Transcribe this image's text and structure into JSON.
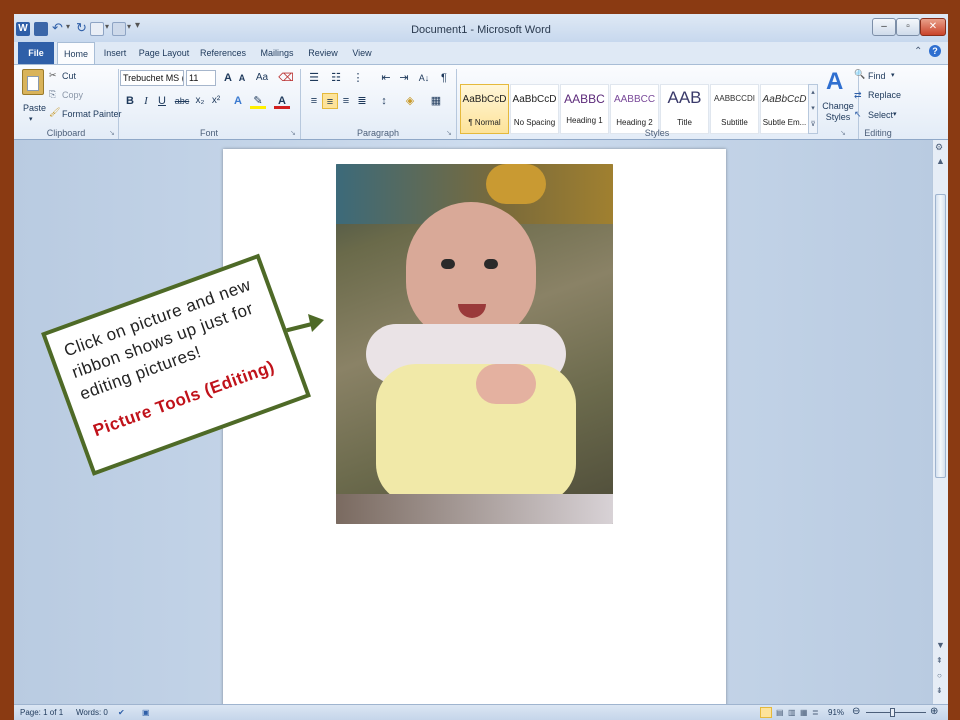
{
  "window": {
    "title": "Document1 - Microsoft Word",
    "qat_icons": [
      "word-app-icon",
      "save-icon",
      "undo-icon",
      "redo-icon",
      "new-doc-icon",
      "print-preview-icon",
      "customize-qat-icon"
    ]
  },
  "tabs": [
    "File",
    "Home",
    "Insert",
    "Page Layout",
    "References",
    "Mailings",
    "Review",
    "View"
  ],
  "active_tab": "Home",
  "clipboard": {
    "paste_label": "Paste",
    "cut_label": "Cut",
    "copy_label": "Copy",
    "format_painter_label": "Format Painter",
    "group_label": "Clipboard"
  },
  "font": {
    "font_name": "Trebuchet MS (H",
    "font_size": "11",
    "group_label": "Font"
  },
  "paragraph": {
    "group_label": "Paragraph"
  },
  "styles": {
    "items": [
      {
        "sample": "AaBbCcD",
        "name": "¶ Normal",
        "color": "#1f1f1f"
      },
      {
        "sample": "AaBbCcD",
        "name": "No Spacing",
        "color": "#1f1f1f"
      },
      {
        "sample": "AABBC",
        "name": "Heading 1",
        "color": "#5c2a7a"
      },
      {
        "sample": "AABBCC",
        "name": "Heading 2",
        "color": "#7a4a9a"
      },
      {
        "sample": "AAB",
        "name": "Title",
        "color": "#3a3a6a"
      },
      {
        "sample": "AABBCCDI",
        "name": "Subtitle",
        "color": "#2f2f2f"
      },
      {
        "sample": "AaBbCcD",
        "name": "Subtle Em...",
        "color": "#333333"
      }
    ],
    "change_styles_label": "Change Styles",
    "group_label": "Styles"
  },
  "editing": {
    "find_label": "Find",
    "replace_label": "Replace",
    "select_label": "Select",
    "group_label": "Editing"
  },
  "status": {
    "page": "Page: 1 of 1",
    "words": "Words: 0",
    "zoom": "91%"
  },
  "callout": {
    "text": "Click on picture and new ribbon shows up just for editing pictures!",
    "emphasis": "Picture Tools (Editing)",
    "border_color": "#4e6a27",
    "emphasis_color": "#c0121a"
  }
}
